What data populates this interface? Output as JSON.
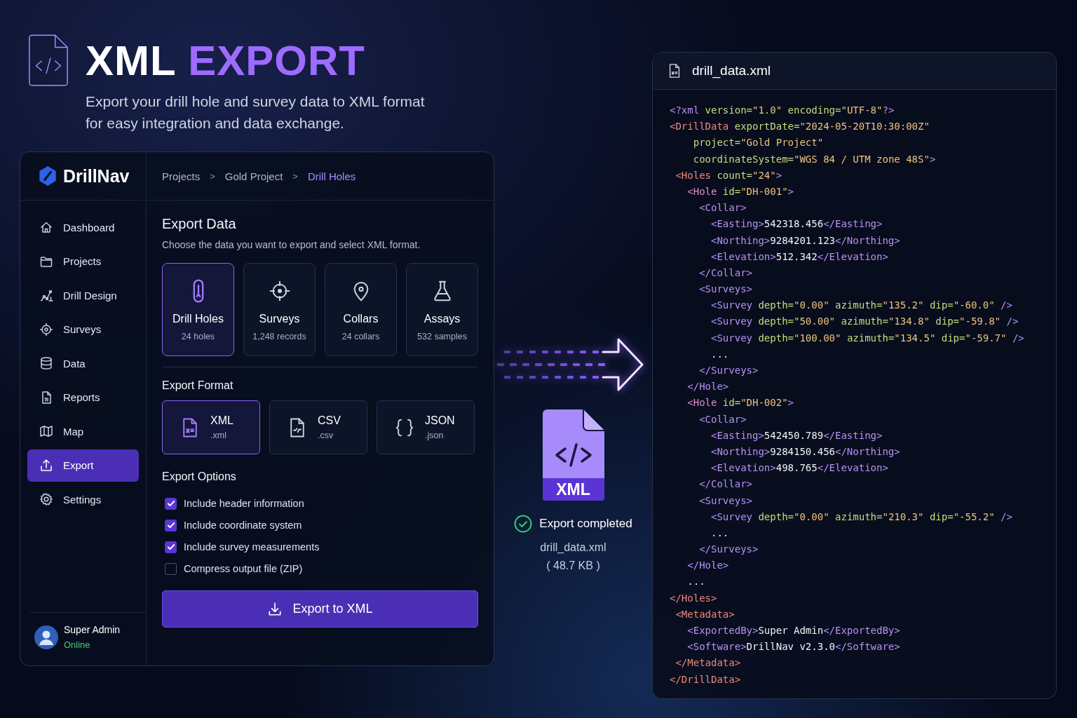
{
  "hero": {
    "title": {
      "lead": "XML",
      "accent": "EXPORT"
    },
    "subtitle": "Export your drill hole and survey data to XML format for easy integration and data exchange."
  },
  "app": {
    "brand": "DrillNav",
    "breadcrumb": [
      {
        "label": "Projects",
        "current": false
      },
      {
        "label": "Gold Project",
        "current": false
      },
      {
        "label": "Drill Holes",
        "current": true
      }
    ],
    "breadcrumb_separator": ">",
    "nav": [
      {
        "label": "Dashboard",
        "selected": false
      },
      {
        "label": "Projects",
        "selected": false
      },
      {
        "label": "Drill Design",
        "selected": false
      },
      {
        "label": "Surveys",
        "selected": false
      },
      {
        "label": "Data",
        "selected": false
      },
      {
        "label": "Reports",
        "selected": false
      },
      {
        "label": "Map",
        "selected": false
      },
      {
        "label": "Export",
        "selected": true
      },
      {
        "label": "Settings",
        "selected": false
      }
    ],
    "user": {
      "name": "Super Admin",
      "status": "Online"
    },
    "export_data": {
      "title": "Export Data",
      "description": "Choose the data you want to export and select XML format.",
      "items": [
        {
          "label": "Drill Holes",
          "count": "24 holes",
          "selected": true
        },
        {
          "label": "Surveys",
          "count": "1,248 records",
          "selected": false
        },
        {
          "label": "Collars",
          "count": "24 collars",
          "selected": false
        },
        {
          "label": "Assays",
          "count": "532 samples",
          "selected": false
        }
      ]
    },
    "export_format": {
      "title": "Export Format",
      "formats": [
        {
          "label": "XML",
          "extension": ".xml",
          "selected": true
        },
        {
          "label": "CSV",
          "extension": ".csv",
          "selected": false
        },
        {
          "label": "JSON",
          "extension": ".json",
          "selected": false
        }
      ]
    },
    "export_options": {
      "title": "Export Options",
      "options": [
        {
          "label": "Include header information",
          "checked": true
        },
        {
          "label": "Include coordinate system",
          "checked": true
        },
        {
          "label": "Include survey measurements",
          "checked": true
        },
        {
          "label": "Compress output file (ZIP)",
          "checked": false
        }
      ]
    },
    "export_button": "Export to XML"
  },
  "result": {
    "file_badge": "XML",
    "status": "Export completed",
    "file_name": "drill_data.xml",
    "file_size": "( 48.7 KB )"
  },
  "preview": {
    "title": "drill_data.xml",
    "lines": [
      [
        {
          "kind": "tag",
          "text": "<?xml "
        },
        {
          "kind": "attr",
          "text": "version="
        },
        {
          "kind": "value",
          "text": "\"1.0\" "
        },
        {
          "kind": "attr",
          "text": "encoding="
        },
        {
          "kind": "value",
          "text": "\"UTF-8\""
        },
        {
          "kind": "tag",
          "text": "?>"
        }
      ],
      [
        {
          "kind": "root",
          "text": "<DrillData "
        },
        {
          "kind": "attr",
          "text": "exportDate="
        },
        {
          "kind": "value",
          "text": "\"2024-05-20T10:30:00Z\""
        }
      ],
      [
        {
          "kind": "attr",
          "text": "    project="
        },
        {
          "kind": "value",
          "text": "\"Gold Project\""
        }
      ],
      [
        {
          "kind": "attr",
          "text": "    coordinateSystem="
        },
        {
          "kind": "value",
          "text": "\"WGS 84 / UTM zone 48S\""
        },
        {
          "kind": "tag",
          "text": ">"
        }
      ],
      [
        {
          "kind": "root",
          "text": " <Holes "
        },
        {
          "kind": "attr",
          "text": "count="
        },
        {
          "kind": "value",
          "text": "\"24\""
        },
        {
          "kind": "tag",
          "text": ">"
        }
      ],
      [
        {
          "kind": "hole",
          "text": "   <Hole "
        },
        {
          "kind": "attr",
          "text": "id="
        },
        {
          "kind": "value",
          "text": "\"DH-001\""
        },
        {
          "kind": "tag",
          "text": ">"
        }
      ],
      [
        {
          "kind": "tag",
          "text": "     <Collar>"
        }
      ],
      [
        {
          "kind": "tag",
          "text": "       <Easting>"
        },
        {
          "kind": "text",
          "text": "542318.456"
        },
        {
          "kind": "tag",
          "text": "</Easting>"
        }
      ],
      [
        {
          "kind": "tag",
          "text": "       <Northing>"
        },
        {
          "kind": "text",
          "text": "9284201.123"
        },
        {
          "kind": "tag",
          "text": "</Northing>"
        }
      ],
      [
        {
          "kind": "tag",
          "text": "       <Elevation>"
        },
        {
          "kind": "text",
          "text": "512.342"
        },
        {
          "kind": "tag",
          "text": "</Elevation>"
        }
      ],
      [
        {
          "kind": "tag",
          "text": "     </Collar>"
        }
      ],
      [
        {
          "kind": "tag",
          "text": "     <Surveys>"
        }
      ],
      [
        {
          "kind": "tag",
          "text": "       <Survey "
        },
        {
          "kind": "attr",
          "text": "depth="
        },
        {
          "kind": "value",
          "text": "\"0.00\" "
        },
        {
          "kind": "attr",
          "text": "azimuth="
        },
        {
          "kind": "value",
          "text": "\"135.2\" "
        },
        {
          "kind": "attr",
          "text": "dip="
        },
        {
          "kind": "value",
          "text": "\"-60.0\" "
        },
        {
          "kind": "tag",
          "text": "/>"
        }
      ],
      [
        {
          "kind": "tag",
          "text": "       <Survey "
        },
        {
          "kind": "attr",
          "text": "depth="
        },
        {
          "kind": "value",
          "text": "\"50.00\" "
        },
        {
          "kind": "attr",
          "text": "azimuth="
        },
        {
          "kind": "value",
          "text": "\"134.8\" "
        },
        {
          "kind": "attr",
          "text": "dip="
        },
        {
          "kind": "value",
          "text": "\"-59.8\" "
        },
        {
          "kind": "tag",
          "text": "/>"
        }
      ],
      [
        {
          "kind": "tag",
          "text": "       <Survey "
        },
        {
          "kind": "attr",
          "text": "depth="
        },
        {
          "kind": "value",
          "text": "\"100.00\" "
        },
        {
          "kind": "attr",
          "text": "azimuth="
        },
        {
          "kind": "value",
          "text": "\"134.5\" "
        },
        {
          "kind": "attr",
          "text": "dip="
        },
        {
          "kind": "value",
          "text": "\"-59.7\" "
        },
        {
          "kind": "tag",
          "text": "/>"
        }
      ],
      [
        {
          "kind": "text",
          "text": "       ..."
        }
      ],
      [
        {
          "kind": "tag",
          "text": "     </Surveys>"
        }
      ],
      [
        {
          "kind": "tag",
          "text": "   </Hole>"
        }
      ],
      [
        {
          "kind": "hole",
          "text": "   <Hole "
        },
        {
          "kind": "attr",
          "text": "id="
        },
        {
          "kind": "value",
          "text": "\"DH-002\""
        },
        {
          "kind": "tag",
          "text": ">"
        }
      ],
      [
        {
          "kind": "tag",
          "text": "     <Collar>"
        }
      ],
      [
        {
          "kind": "tag",
          "text": "       <Easting>"
        },
        {
          "kind": "text",
          "text": "542450.789"
        },
        {
          "kind": "tag",
          "text": "</Easting>"
        }
      ],
      [
        {
          "kind": "tag",
          "text": "       <Northing>"
        },
        {
          "kind": "text",
          "text": "9284150.456"
        },
        {
          "kind": "tag",
          "text": "</Northing>"
        }
      ],
      [
        {
          "kind": "tag",
          "text": "       <Elevation>"
        },
        {
          "kind": "text",
          "text": "498.765"
        },
        {
          "kind": "tag",
          "text": "</Elevation>"
        }
      ],
      [
        {
          "kind": "tag",
          "text": "     </Collar>"
        }
      ],
      [
        {
          "kind": "tag",
          "text": "     <Surveys>"
        }
      ],
      [
        {
          "kind": "tag",
          "text": "       <Survey "
        },
        {
          "kind": "attr",
          "text": "depth="
        },
        {
          "kind": "value",
          "text": "\"0.00\" "
        },
        {
          "kind": "attr",
          "text": "azimuth="
        },
        {
          "kind": "value",
          "text": "\"210.3\" "
        },
        {
          "kind": "attr",
          "text": "dip="
        },
        {
          "kind": "value",
          "text": "\"-55.2\" "
        },
        {
          "kind": "tag",
          "text": "/>"
        }
      ],
      [
        {
          "kind": "text",
          "text": "       ..."
        }
      ],
      [
        {
          "kind": "tag",
          "text": "     </Surveys>"
        }
      ],
      [
        {
          "kind": "tag",
          "text": "   </Hole>"
        }
      ],
      [
        {
          "kind": "text",
          "text": "   ..."
        }
      ],
      [
        {
          "kind": "root",
          "text": "</Holes>"
        }
      ],
      [
        {
          "kind": "root",
          "text": " <Metadata>"
        }
      ],
      [
        {
          "kind": "tag",
          "text": "   <ExportedBy>"
        },
        {
          "kind": "text",
          "text": "Super Admin"
        },
        {
          "kind": "tag",
          "text": "</ExportedBy>"
        }
      ],
      [
        {
          "kind": "tag",
          "text": "   <Software>"
        },
        {
          "kind": "text",
          "text": "DrillNav v2.3.0"
        },
        {
          "kind": "tag",
          "text": "</Software>"
        }
      ],
      [
        {
          "kind": "root",
          "text": " </Metadata>"
        }
      ],
      [
        {
          "kind": "root",
          "text": "</DrillData>"
        }
      ]
    ]
  }
}
